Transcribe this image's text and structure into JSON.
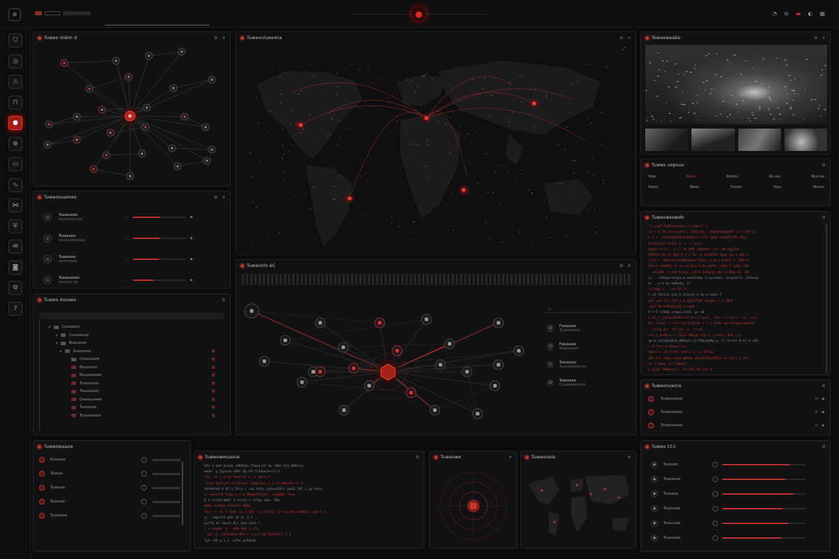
{
  "top_bar": {
    "logo_glyph": "⍟",
    "center_indicator": "●",
    "right_icons": [
      "bell-icon",
      "link-icon",
      "cast-icon",
      "user-icon",
      "grid-icon"
    ]
  },
  "sidebar": {
    "items": [
      {
        "icon": "shield-icon",
        "glyph": "⛉"
      },
      {
        "icon": "target-icon",
        "glyph": "◎"
      },
      {
        "icon": "alert-icon",
        "glyph": "⚠"
      },
      {
        "icon": "lock-icon",
        "glyph": "⊓"
      },
      {
        "icon": "radar-icon",
        "glyph": "●",
        "active": true
      },
      {
        "icon": "globe-icon",
        "glyph": "⊕"
      },
      {
        "icon": "chat-icon",
        "glyph": "▭"
      },
      {
        "icon": "wave-icon",
        "glyph": "∿"
      },
      {
        "icon": "network-icon",
        "glyph": "⋈"
      },
      {
        "icon": "shield-check-icon",
        "glyph": "⛨"
      },
      {
        "icon": "mail-icon",
        "glyph": "✉"
      },
      {
        "icon": "camera-icon",
        "glyph": "◙"
      },
      {
        "icon": "settings-icon",
        "glyph": "⚙"
      },
      {
        "icon": "help-icon",
        "glyph": "?"
      }
    ]
  },
  "panels": {
    "network_graph": {
      "title": "Tuweo mdim d"
    },
    "world_map": {
      "title": "Tuweonlueemie",
      "expand": "⤢"
    },
    "camera": {
      "title": "Toweowaabo"
    },
    "stats_row": {
      "title": "Tuweo uopsuo",
      "rows": [
        [
          "Yoos",
          "Bu∞s",
          "Noorcs",
          "Vu∞ou",
          "Wucrao"
        ],
        [
          "Yooos",
          "Woos",
          "Dusoo",
          "Yous",
          "Woons"
        ]
      ]
    },
    "terminal_log": {
      "title": "Tuweowsowdo"
    },
    "threat_bars": {
      "title": "Tuweonuamoo",
      "items": [
        {
          "label": "Tuoaouooo",
          "sub": "lauonooosues"
        },
        {
          "label": "Tuoaouoo",
          "sub": "lauouoooooose"
        },
        {
          "label": "Tuoaouoo",
          "sub": "lauonoaoe"
        },
        {
          "label": "Tuoaouooso",
          "sub": "lauuooe oe"
        }
      ]
    },
    "relation_graph": {
      "title": "Tuweonlo eC"
    },
    "file_tree": {
      "title": "Tuweo mouwo",
      "items": [
        "Cuoauooe",
        "Cuunoovoe",
        "Buouoooe",
        "Duoouooe",
        "Cooouuuoe",
        "Rououovo",
        "Ruuouuooee",
        "Tuoouuuoo",
        "Teouuoeoo",
        "Duoouuveeo",
        "Tuoooooo",
        "Tuuuoouuuo"
      ]
    },
    "contacts": {
      "items": [
        {
          "name": "Fuouuseo",
          "sub": "Tuoeoooouo"
        },
        {
          "name": "Fuouuseo",
          "sub": "Bouoouooo"
        },
        {
          "name": "Yuouuuso",
          "sub": "Tuuvoooouo uo"
        },
        {
          "name": "Toaooooo",
          "sub": "Cuuoooooouuo"
        }
      ]
    },
    "alerts_small": {
      "title": "Tuweonuenio",
      "items": [
        "Tuweoueoua",
        "Tuweooueoe",
        "Tuweouuooe"
      ]
    },
    "bottom_list": {
      "title": "Tuweowaaoe",
      "items": [
        "Euouooe",
        "Tuoouo",
        "Tuoooue",
        "Tuoooue",
        "Tuooouoe"
      ]
    },
    "bottom_terminal": {
      "title": "Tuweowmuonie"
    },
    "radar": {
      "title": "Tuweowe"
    },
    "mini_map": {
      "title": "Tuweonole"
    },
    "bottom_bars": {
      "title": "Tuweo Ct:t",
      "items": [
        "Tuoouoo",
        "Tuooouue",
        "Tuoooue",
        "Tuoouuee",
        "Tuoouuee",
        "Tuooouee"
      ]
    }
  },
  "colors": {
    "accent": "#d0352a",
    "panel": "#121214",
    "bg": "#0b0b0c"
  }
}
